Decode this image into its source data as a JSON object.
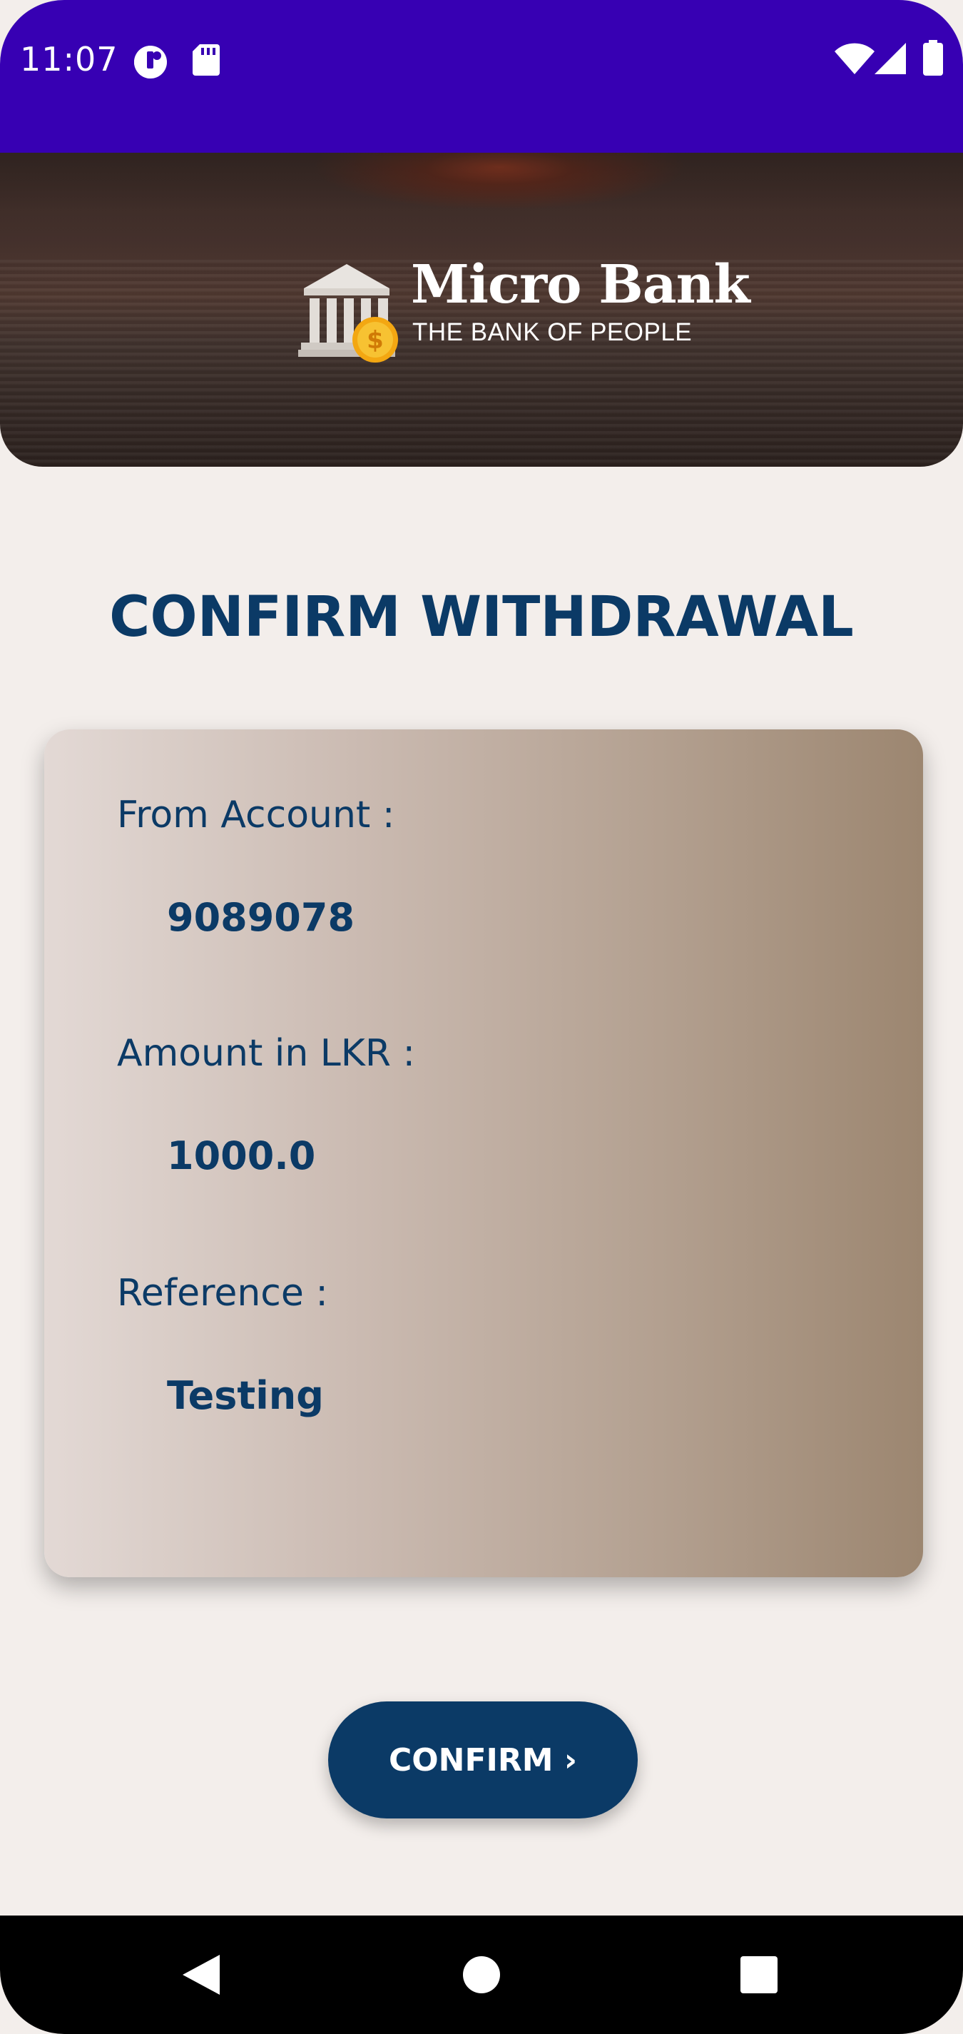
{
  "status_bar": {
    "time": "11:07",
    "icons": [
      "data-saver-icon",
      "sd-card-icon",
      "wifi-icon",
      "signal-icon",
      "battery-icon"
    ]
  },
  "banner": {
    "logo_title": "Micro Bank",
    "logo_subtitle": "THE BANK OF PEOPLE",
    "logo_icon": "bank-building-icon",
    "coin_symbol": "$"
  },
  "page": {
    "title": "CONFIRM WITHDRAWAL"
  },
  "details": {
    "from_account_label": "From Account :",
    "from_account_value": "9089078",
    "amount_label": "Amount in LKR :",
    "amount_value": "1000.0",
    "reference_label": "Reference :",
    "reference_value": "Testing"
  },
  "actions": {
    "confirm_label": "CONFIRM ›"
  },
  "nav": {
    "icons": [
      "back-icon",
      "home-icon",
      "recents-icon"
    ]
  },
  "colors": {
    "status_bar": "#3700b3",
    "primary": "#0b3a66",
    "background": "#f3eeeb"
  }
}
